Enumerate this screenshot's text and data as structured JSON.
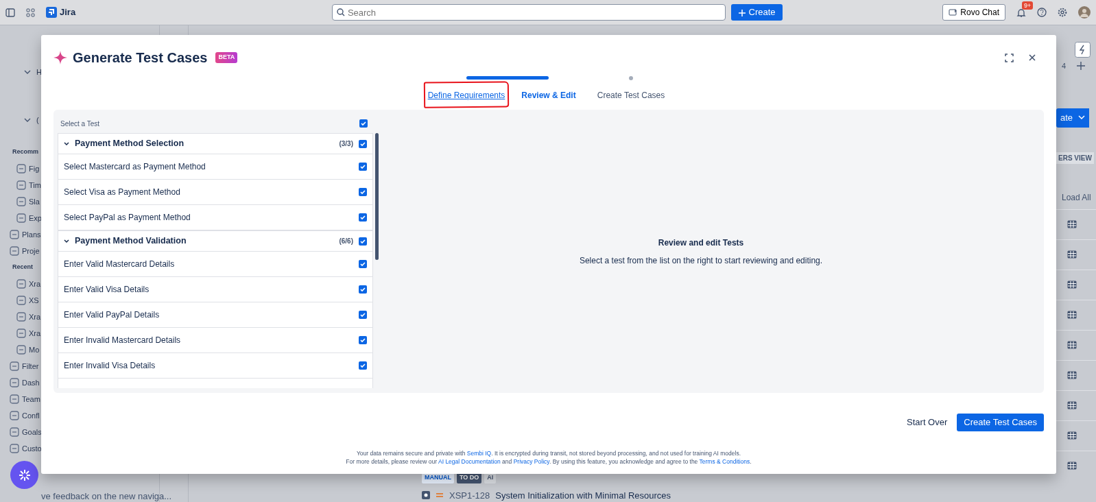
{
  "topbar": {
    "app_name": "Jira",
    "search": {
      "placeholder": "Search"
    },
    "create_label": "Create",
    "rovo_label": "Rovo Chat",
    "notification_badge": "9+"
  },
  "sidebar": {
    "items": [
      {
        "label": "H",
        "kind": "expander"
      },
      {
        "label": "(",
        "kind": "expander"
      },
      {
        "label": "Recomm",
        "kind": "heading"
      },
      {
        "label": "Fig",
        "kind": "subitem"
      },
      {
        "label": "Tim",
        "kind": "subitem"
      },
      {
        "label": "Sla",
        "kind": "subitem"
      },
      {
        "label": "Exp",
        "kind": "subitem"
      },
      {
        "label": "Plans",
        "kind": "item"
      },
      {
        "label": "Proje",
        "kind": "item"
      },
      {
        "label": "Recent",
        "kind": "heading"
      },
      {
        "label": "Xra",
        "kind": "subitem"
      },
      {
        "label": "XS",
        "kind": "subitem"
      },
      {
        "label": "Xra",
        "kind": "subitem"
      },
      {
        "label": "Xra",
        "kind": "subitem"
      },
      {
        "label": "Mo",
        "kind": "subitem"
      },
      {
        "label": "Filter",
        "kind": "item"
      },
      {
        "label": "Dash",
        "kind": "item"
      },
      {
        "label": "Team",
        "kind": "item"
      },
      {
        "label": "Confl",
        "kind": "item"
      },
      {
        "label": "Goals",
        "kind": "item"
      },
      {
        "label": "Custo",
        "kind": "item"
      }
    ],
    "feedback_text": "ve feedback on the new naviga..."
  },
  "board": {
    "counter": "4",
    "create_button": "ate",
    "view_badge": "ERS VIEW",
    "load_all": "Load All",
    "issue": {
      "tags": [
        "MANUAL",
        "TO DO",
        "AI"
      ],
      "key": "XSP1-128",
      "summary": "System Initialization with Minimal Resources"
    }
  },
  "modal": {
    "title": "Generate Test Cases",
    "badge": "BETA",
    "progress": {
      "level": 0.5
    },
    "steps": [
      {
        "label": "Define Requirements",
        "kind": "done",
        "highlighted": true
      },
      {
        "label": "Review & Edit",
        "kind": "current",
        "highlighted": false
      },
      {
        "label": "Create Test Cases",
        "kind": "pending",
        "highlighted": false
      }
    ],
    "list_header": "Select a Test",
    "select_all_checked": true,
    "groups": [
      {
        "title": "Payment Method Selection",
        "count": "(3/3)",
        "expanded": true,
        "checked": true,
        "tests": [
          {
            "label": "Select Mastercard as Payment Method",
            "checked": true
          },
          {
            "label": "Select Visa as Payment Method",
            "checked": true
          },
          {
            "label": "Select PayPal as Payment Method",
            "checked": true
          }
        ]
      },
      {
        "title": "Payment Method Validation",
        "count": "(6/6)",
        "expanded": true,
        "checked": true,
        "tests": [
          {
            "label": "Enter Valid Mastercard Details",
            "checked": true
          },
          {
            "label": "Enter Valid Visa Details",
            "checked": true
          },
          {
            "label": "Enter Valid PayPal Details",
            "checked": true
          },
          {
            "label": "Enter Invalid Mastercard Details",
            "checked": true
          },
          {
            "label": "Enter Invalid Visa Details",
            "checked": true
          }
        ]
      }
    ],
    "empty_title": "Review and edit Tests",
    "empty_text": "Select a test from the list on the right to start reviewing and editing.",
    "secondary_button": "Start Over",
    "primary_button": "Create Test Cases",
    "disclaimer": [
      [
        {
          "text": "Your data remains secure and private with ",
          "kind": "text"
        },
        {
          "text": "Sembi IQ",
          "kind": "link"
        },
        {
          "text": ". It is encrypted during transit, not stored beyond processing, and not used for training AI models.",
          "kind": "text"
        }
      ],
      [
        {
          "text": "For more details, please review our ",
          "kind": "text"
        },
        {
          "text": "AI Legal Documentation",
          "kind": "link"
        },
        {
          "text": " and ",
          "kind": "text"
        },
        {
          "text": "Privacy Policy",
          "kind": "link"
        },
        {
          "text": ". By using this feature, you acknowledge and agree to the ",
          "kind": "text"
        },
        {
          "text": "Terms & Conditions",
          "kind": "link"
        },
        {
          "text": ".",
          "kind": "text"
        }
      ]
    ]
  }
}
